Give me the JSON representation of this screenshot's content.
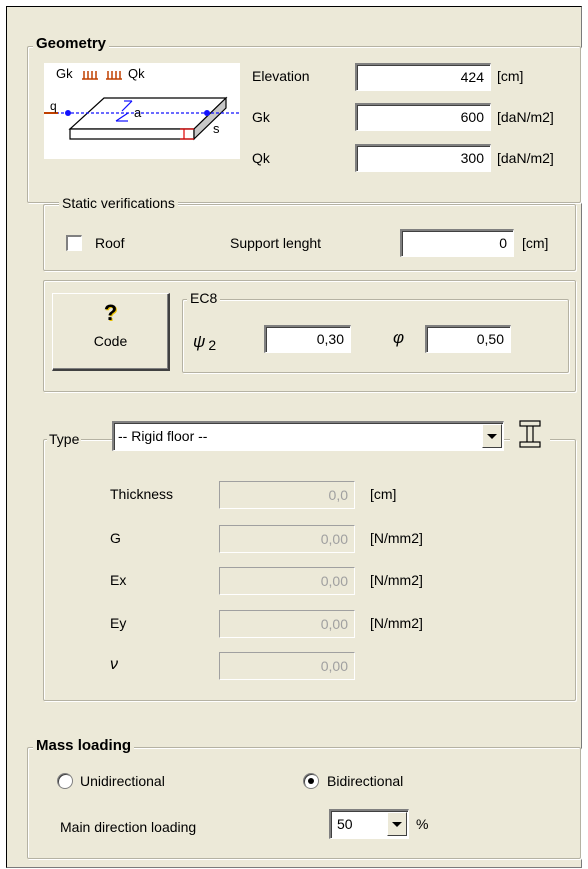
{
  "geometry": {
    "title": "Geometry",
    "diagram": {
      "gk": "Gk",
      "qk": "Qk",
      "q": "q",
      "a": "a",
      "s": "s"
    },
    "elevation": {
      "label": "Elevation",
      "value": "424",
      "unit": "[cm]"
    },
    "gk": {
      "label": "Gk",
      "value": "600",
      "unit": "[daN/m2]"
    },
    "qk": {
      "label": "Qk",
      "value": "300",
      "unit": "[daN/m2]"
    }
  },
  "static": {
    "title": "Static verifications",
    "roof_label": "Roof",
    "roof_checked": false,
    "support_label": "Support lenght",
    "support_value": "0",
    "support_unit": "[cm]"
  },
  "code": {
    "label": "Code",
    "icon": "question-mark-icon"
  },
  "ec8": {
    "title": "EC8",
    "psi_symbol": "ψ",
    "psi_sub": "2",
    "psi_value": "0,30",
    "phi_symbol": "φ",
    "phi_value": "0,50"
  },
  "type": {
    "label": "Type",
    "selected": "-- Rigid floor --",
    "fields": [
      {
        "label": "Thickness",
        "value": "0,0",
        "unit": "[cm]"
      },
      {
        "label": "G",
        "value": "0,00",
        "unit": "[N/mm2]"
      },
      {
        "label": "Ex",
        "value": "0,00",
        "unit": "[N/mm2]"
      },
      {
        "label": "Ey",
        "value": "0,00",
        "unit": "[N/mm2]"
      },
      {
        "label": "ν",
        "value": "0,00",
        "unit": ""
      }
    ]
  },
  "mass": {
    "title": "Mass loading",
    "option1": "Unidirectional",
    "option2": "Bidirectional",
    "selected": "Bidirectional",
    "main_dir_label": "Main direction loading",
    "main_dir_value": "50",
    "percent": "%"
  },
  "colors": {
    "panel_bg": "#ece9d8",
    "load_arrows": "#c04000",
    "axis_line": "#1010ff"
  }
}
